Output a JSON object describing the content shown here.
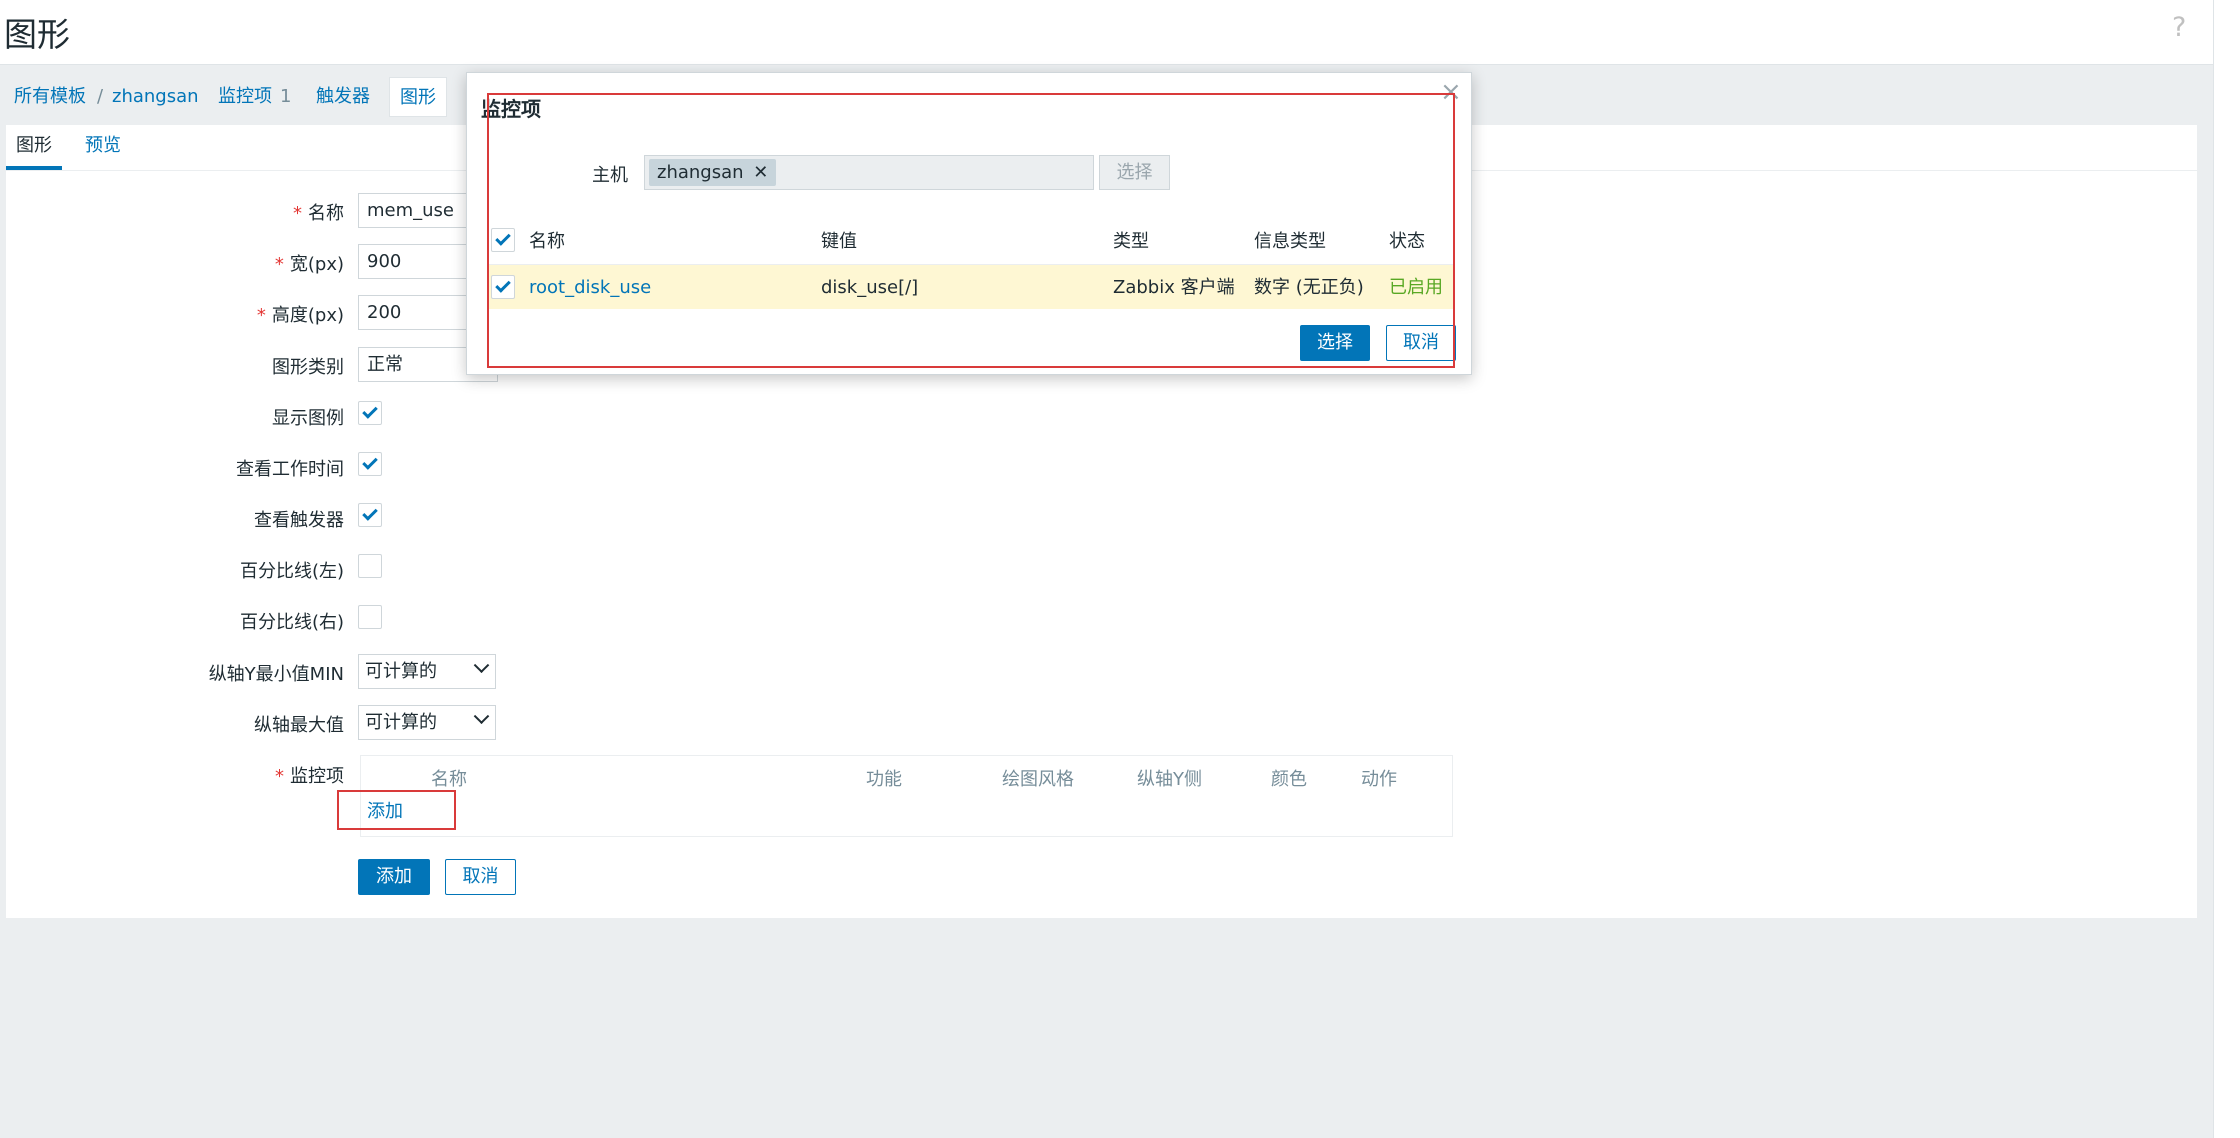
{
  "page": {
    "title": "图形"
  },
  "nav": {
    "items": [
      {
        "label": "所有模板"
      },
      {
        "label": "zhangsan"
      },
      {
        "label": "监控项",
        "count": "1"
      },
      {
        "label": "触发器"
      },
      {
        "label": "图形"
      }
    ],
    "separator": "/"
  },
  "tabs": [
    {
      "label": "图形"
    },
    {
      "label": "预览"
    }
  ],
  "form": {
    "name_label": "名称",
    "name_value": "mem_use",
    "width_label": "宽(px)",
    "width_value": "900",
    "height_label": "高度(px)",
    "height_value": "200",
    "graph_type_label": "图形类别",
    "graph_type_value": "正常",
    "show_legend_label": "显示图例",
    "show_work_period_label": "查看工作时间",
    "show_triggers_label": "查看触发器",
    "percentile_left_label": "百分比线(左)",
    "percentile_right_label": "百分比线(右)",
    "ymin_label": "纵轴Y最小值MIN",
    "ymin_value": "可计算的",
    "ymax_label": "纵轴最大值",
    "ymax_value": "可计算的",
    "items_label": "监控项",
    "items_columns": [
      "名称",
      "功能",
      "绘图风格",
      "纵轴Y侧",
      "颜色",
      "动作"
    ],
    "items_add_link": "添加",
    "submit_label": "添加",
    "cancel_label": "取消"
  },
  "modal": {
    "title": "监控项",
    "host_label": "主机",
    "host_tag": "zhangsan",
    "select_label": "选择",
    "columns": [
      "名称",
      "键值",
      "类型",
      "信息类型",
      "状态"
    ],
    "rows": [
      {
        "name": "root_disk_use",
        "key": "disk_use[/]",
        "type": "Zabbix 客户端",
        "info_type": "数字 (无正负)",
        "status": "已启用"
      }
    ],
    "confirm_label": "选择",
    "cancel_label": "取消"
  },
  "colors": {
    "accent": "#0275b8",
    "highlight_row": "#fef7d3",
    "enabled": "#59a824",
    "annotation": "#d93a3a"
  }
}
